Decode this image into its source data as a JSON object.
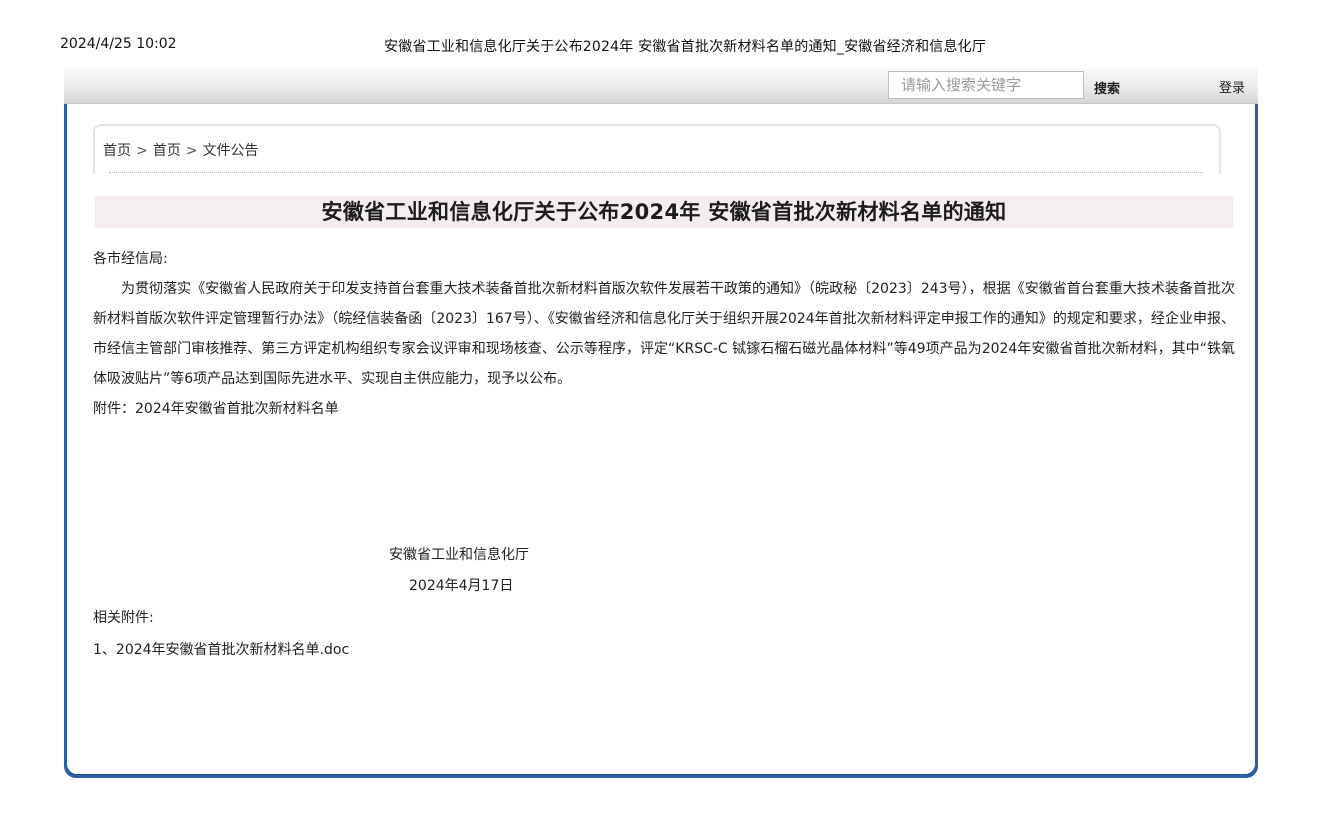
{
  "print_header": {
    "datetime": "2024/4/25 10:02",
    "page_title": "安徽省工业和信息化厅关于公布2024年 安徽省首批次新材料名单的通知_安徽省经济和信息化厅"
  },
  "topbar": {
    "search_placeholder": "请输入搜索关键字",
    "search_label": "搜索",
    "login_label": "登录"
  },
  "breadcrumb": {
    "items": [
      "首页",
      "首页",
      "文件公告"
    ],
    "separator": ">"
  },
  "article": {
    "title": "安徽省工业和信息化厅关于公布2024年 安徽省首批次新材料名单的通知",
    "salutation": "各市经信局:",
    "body": "为贯彻落实《安徽省人民政府关于印发支持首台套重大技术装备首批次新材料首版次软件发展若干政策的通知》（皖政秘〔2023〕243号），根据《安徽省首台套重大技术装备首批次新材料首版次软件评定管理暂行办法》（皖经信装备函〔2023〕167号）、《安徽省经济和信息化厅关于组织开展2024年首批次新材料评定申报工作的通知》的规定和要求，经企业申报、市经信主管部门审核推荐、第三方评定机构组织专家会议评审和现场核查、公示等程序，评定“KRSC-C 铽镓石榴石磁光晶体材料”等49项产品为2024年安徽省首批次新材料，其中“铁氧体吸波贴片”等6项产品达到国际先进水平、实现自主供应能力，现予以公布。",
    "attachment": "附件：2024年安徽省首批次新材料名单",
    "signature_org": "安徽省工业和信息化厅",
    "signature_date": "2024年4月17日",
    "related_label": "相关附件:",
    "related_files": [
      "1、2024年安徽省首批次新材料名单.doc"
    ]
  },
  "colors": {
    "frame_border": "#2e5fa3",
    "title_bg": "#f3eded"
  }
}
